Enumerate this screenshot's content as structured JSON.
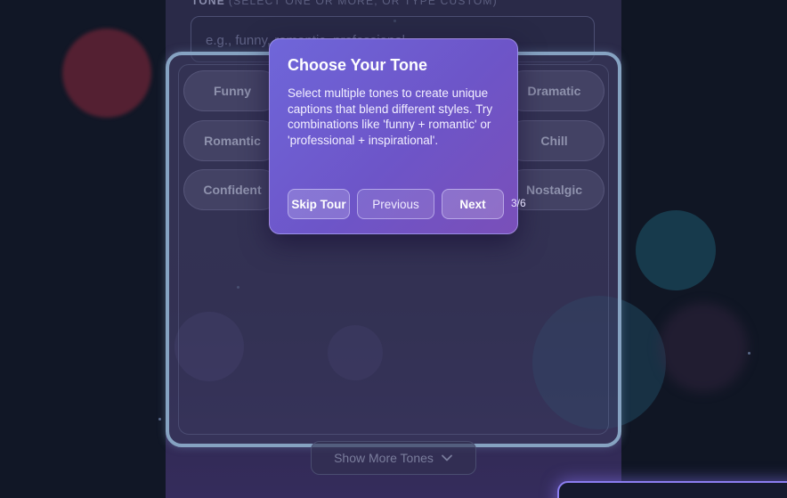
{
  "tone_section": {
    "label": "TONE",
    "hint": "(SELECT ONE OR MORE, OR TYPE CUSTOM)",
    "input_placeholder": "e.g., funny, romantic, professional"
  },
  "tones": [
    {
      "label": "Funny"
    },
    {
      "label": "Dramatic"
    },
    {
      "label": "Romantic"
    },
    {
      "label": "Chill"
    },
    {
      "label": "Confident"
    },
    {
      "label": "Nostalgic"
    }
  ],
  "show_more_label": "Show More Tones",
  "tour": {
    "title": "Choose Your Tone",
    "body": "Select multiple tones to create unique captions that blend different styles. Try combinations like 'funny + romantic' or 'professional + inspirational'.",
    "skip_label": "Skip Tour",
    "previous_label": "Previous",
    "next_label": "Next",
    "step": "3/6"
  },
  "colors": {
    "accent": "#6f66d9",
    "highlight_border": "#86a3c2",
    "background": "#0f1424"
  }
}
